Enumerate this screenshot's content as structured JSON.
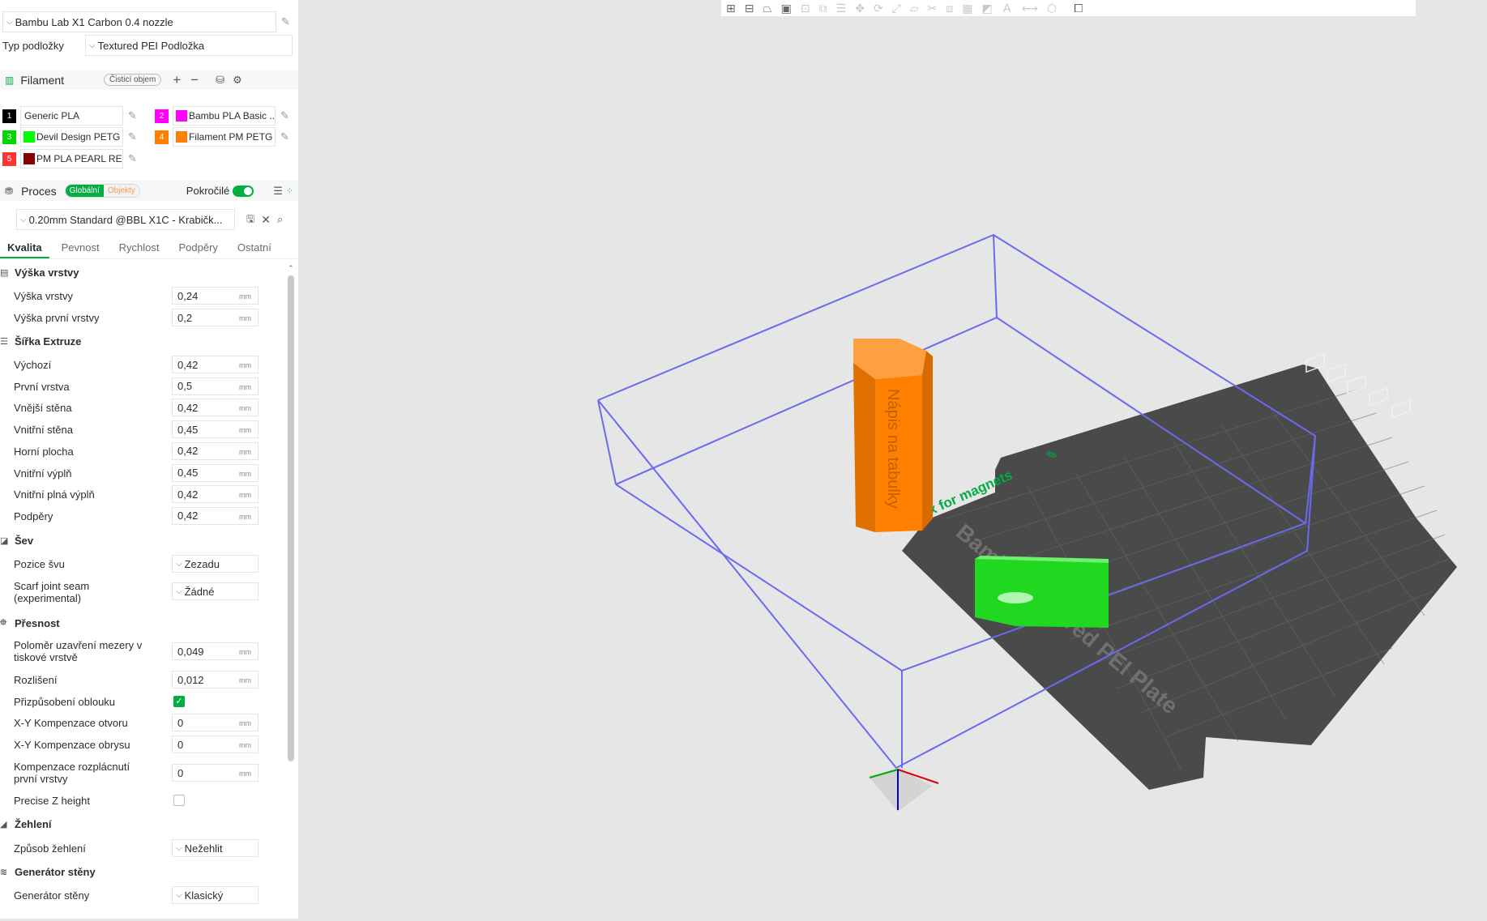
{
  "printer": {
    "name": "Bambu Lab X1 Carbon 0.4 nozzle",
    "plate_label": "Typ podložky",
    "plate_value": "Textured PEI Podložka"
  },
  "filament": {
    "title": "Filament",
    "purge_button": "Čisticí objem",
    "items": [
      {
        "num": "1",
        "num_color": "#000000",
        "swatch": "",
        "name": "Generic PLA"
      },
      {
        "num": "2",
        "num_color": "#ff00ff",
        "swatch": "#ff00ff",
        "name": "Bambu PLA Basic ..."
      },
      {
        "num": "3",
        "num_color": "#00d800",
        "swatch": "#00ff00",
        "name": "Devil Design PETG ..."
      },
      {
        "num": "4",
        "num_color": "#ff8000",
        "swatch": "#ff8000",
        "name": "Filament PM PETG ..."
      },
      {
        "num": "5",
        "num_color": "#ff3333",
        "swatch": "#8b0000",
        "name": "PM PLA PEARL RED"
      }
    ]
  },
  "process": {
    "title": "Proces",
    "global_label": "Globální",
    "objects_label": "Objekty",
    "advanced_label": "Pokročilé",
    "preset": "0.20mm Standard @BBL X1C - Krabičk..."
  },
  "tabs": [
    "Kvalita",
    "Pevnost",
    "Rychlost",
    "Podpěry",
    "Ostatní"
  ],
  "groups": {
    "layer_height": {
      "title": "Výška vrstvy",
      "params": [
        {
          "label": "Výška vrstvy",
          "value": "0,24",
          "unit": "mm"
        },
        {
          "label": "Výška první vrstvy",
          "value": "0,2",
          "unit": "mm"
        }
      ]
    },
    "line_width": {
      "title": "Šířka Extruze",
      "params": [
        {
          "label": "Výchozí",
          "value": "0,42",
          "unit": "mm"
        },
        {
          "label": "První vrstva",
          "value": "0,5",
          "unit": "mm"
        },
        {
          "label": "Vnější stěna",
          "value": "0,42",
          "unit": "mm"
        },
        {
          "label": "Vnitřní stěna",
          "value": "0,45",
          "unit": "mm"
        },
        {
          "label": "Horní plocha",
          "value": "0,42",
          "unit": "mm"
        },
        {
          "label": "Vnitřní výplň",
          "value": "0,45",
          "unit": "mm"
        },
        {
          "label": "Vnitřní plná výplň",
          "value": "0,42",
          "unit": "mm"
        },
        {
          "label": "Podpěry",
          "value": "0,42",
          "unit": "mm"
        }
      ]
    },
    "seam": {
      "title": "Šev",
      "position_label": "Pozice švu",
      "position_value": "Zezadu",
      "scarf_label_1": "Scarf joint seam",
      "scarf_label_2": "(experimental)",
      "scarf_value": "Žádné"
    },
    "precision": {
      "title": "Přesnost",
      "slice_closing_label_1": "Poloměr uzavření mezery v",
      "slice_closing_label_2": "tiskové vrstvě",
      "slice_closing_value": "0,049",
      "resolution_label": "Rozlišení",
      "resolution_value": "0,012",
      "arc_fitting_label": "Přizpůsobení oblouku",
      "arc_fitting_checked": true,
      "xy_hole_label": "X-Y Kompenzace otvoru",
      "xy_hole_value": "0",
      "xy_contour_label": "X-Y Kompenzace obrysu",
      "xy_contour_value": "0",
      "elephant_label_1": "Kompenzace rozplácnutí",
      "elephant_label_2": "první vrstvy",
      "elephant_value": "0",
      "precise_z_label": "Precise Z height",
      "precise_z_checked": false,
      "unit": "mm"
    },
    "ironing": {
      "title": "Žehlení",
      "type_label": "Způsob žehlení",
      "type_value": "Nežehlit"
    },
    "wall_generator": {
      "title": "Generátor stěny",
      "label": "Generátor stěny",
      "value": "Klasický"
    }
  },
  "viewport": {
    "plate_label": "Bambu Textured PEI Plate",
    "box_label": "Box for magnets",
    "box_icon": "edit-pencil-icon",
    "plate_number": "01",
    "tower_text": "Nápis na tabulky",
    "colors": {
      "tower": "#ff8000",
      "small_part": "#1fd81f",
      "bed": "#4a4a4a",
      "volume": "#6a6af0",
      "accent": "#00ae42"
    }
  }
}
